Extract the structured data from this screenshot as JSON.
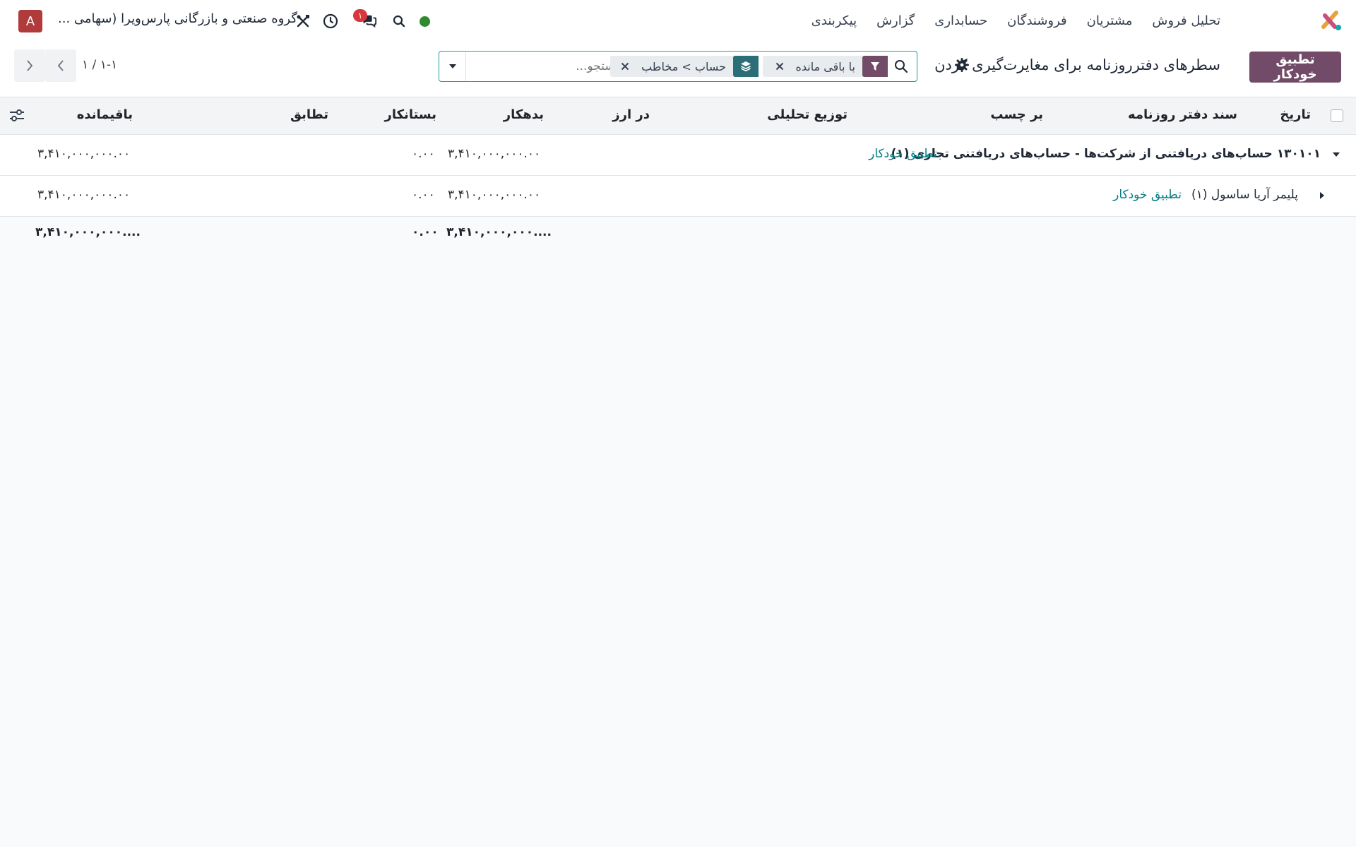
{
  "navbar": {
    "menu": [
      "تحلیل فروش",
      "مشتریان",
      "فروشندگان",
      "حسابداری",
      "گزارش",
      "پیکربندی"
    ],
    "company": "گروه صنعتی و بازرگانی پارس‌ویرا (سهامی ...",
    "avatar_letter": "A",
    "chat_badge": "۱",
    "icons": [
      "app-logo-icon",
      "search-icon",
      "chat-icon",
      "clock-icon",
      "tools-icon"
    ],
    "status_color": "#2e8b2e"
  },
  "control": {
    "primary_button": "تطبیق خودکار",
    "title": "سطرهای دفترروزنامه برای مغایرت‌گیری کردن",
    "search": {
      "placeholder": "جستجو...",
      "facets": [
        {
          "label": "با باقی مانده",
          "icon": "filter-icon"
        },
        {
          "label": "حساب > مخاطب",
          "icon": "group-by-icon"
        }
      ]
    },
    "pager": "۱-۱ / ۱"
  },
  "table": {
    "headers": {
      "date": "تاریخ",
      "move": "سند دفتر روزنامه",
      "label": "بر چسب",
      "analytic": "توزیع تحلیلی",
      "currency": "در ارز",
      "debit": "بدهکار",
      "credit": "بستانکار",
      "matching": "تطابق",
      "residual": "باقیمانده"
    },
    "groups": [
      {
        "label": "۱۳۰۱۰۱ حساب‌های دریافتنی از شرکت‌ها - حساب‌های دریافتنی تجاری (۱)",
        "action": "تطبیق خودکار",
        "debit": "۳,۴۱۰,۰۰۰,۰۰۰.۰۰",
        "credit": "۰.۰۰",
        "residual": "۳,۴۱۰,۰۰۰,۰۰۰.۰۰"
      },
      {
        "label": "پلیمر آریا ساسول (۱)",
        "action": "تطبیق خودکار",
        "debit": "۳,۴۱۰,۰۰۰,۰۰۰.۰۰",
        "credit": "۰.۰۰",
        "residual": "۳,۴۱۰,۰۰۰,۰۰۰.۰۰"
      }
    ],
    "totals": {
      "debit": "۳,۴۱۰,۰۰۰,۰۰۰....",
      "credit": "۰.۰۰",
      "residual": "۳,۴۱۰,۰۰۰,۰۰۰...."
    }
  },
  "colors": {
    "primary": "#714b67",
    "accent": "#017e84"
  }
}
